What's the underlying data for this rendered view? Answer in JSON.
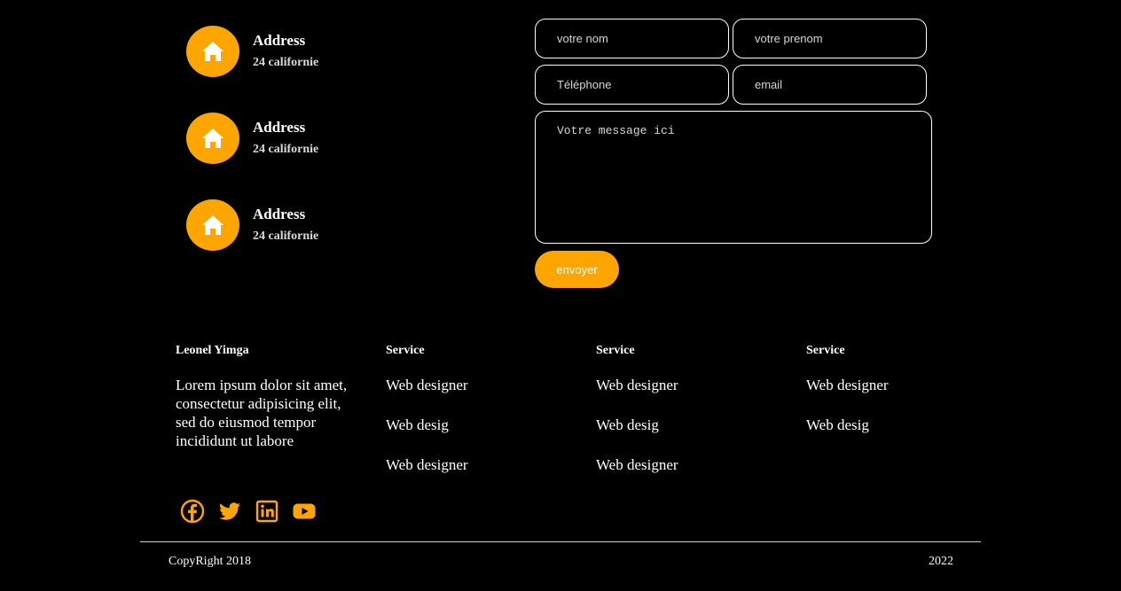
{
  "contact": {
    "items": [
      {
        "title": "Address",
        "value": "24 californie",
        "icon": "home-icon"
      },
      {
        "title": "Address",
        "value": "24 californie",
        "icon": "home-icon"
      },
      {
        "title": "Address",
        "value": "24 californie",
        "icon": "home-icon"
      }
    ]
  },
  "form": {
    "nom_placeholder": "votre nom",
    "prenom_placeholder": "votre prenom",
    "telephone_placeholder": "Téléphone",
    "email_placeholder": "email",
    "message_placeholder": "Votre message ici",
    "submit_label": "envoyer"
  },
  "footer": {
    "about": {
      "heading": "Leonel Yimga",
      "text": "Lorem ipsum dolor sit amet, consectetur adipisicing elit, sed do eiusmod tempor incididunt ut labore"
    },
    "columns": [
      {
        "heading": "Service",
        "links": [
          "Web designer",
          "Web desig",
          "Web designer"
        ]
      },
      {
        "heading": "Service",
        "links": [
          "Web designer",
          "Web desig",
          "Web designer"
        ]
      },
      {
        "heading": "Service",
        "links": [
          "Web designer",
          "Web desig"
        ]
      }
    ],
    "social": [
      "facebook-icon",
      "twitter-icon",
      "linkedin-icon",
      "youtube-icon"
    ],
    "copyright": "CopyRight 2018",
    "year": "2022"
  },
  "colors": {
    "accent": "#FFA500",
    "background": "#000000",
    "text": "#FFFFFF"
  }
}
